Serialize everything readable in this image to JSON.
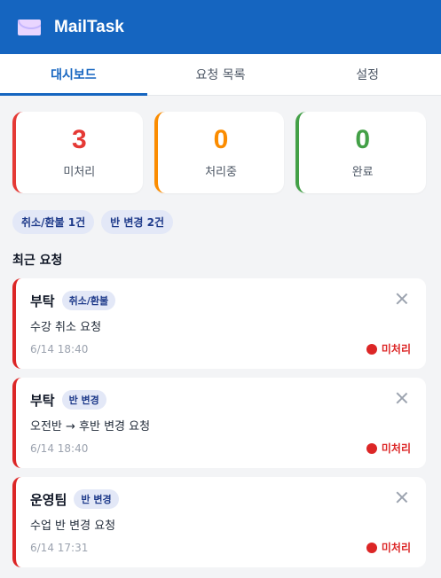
{
  "app": {
    "title": "MailTask",
    "icon": "envelope-icon"
  },
  "tabs": [
    {
      "label": "대시보드",
      "active": true
    },
    {
      "label": "요청 목록",
      "active": false
    },
    {
      "label": "설정",
      "active": false
    }
  ],
  "stats": [
    {
      "value": "3",
      "label": "미처리",
      "color": "#e53935"
    },
    {
      "value": "0",
      "label": "처리중",
      "color": "#fb8c00"
    },
    {
      "value": "0",
      "label": "완료",
      "color": "#43a047"
    }
  ],
  "chips": [
    {
      "label": "취소/환불 1건"
    },
    {
      "label": "반 변경 2건"
    }
  ],
  "recent": {
    "title": "최근 요청",
    "items": [
      {
        "sender": "부탁",
        "badge": "취소/환불",
        "subject": "수강 취소 요청",
        "time": "6/14 18:40",
        "status": "미처리"
      },
      {
        "sender": "부탁",
        "badge": "반 변경",
        "subject": "오전반 → 후반 변경 요청",
        "time": "6/14 18:40",
        "status": "미처리"
      },
      {
        "sender": "운영팀",
        "badge": "반 변경",
        "subject": "수업 반 변경 요청",
        "time": "6/14 17:31",
        "status": "미처리"
      }
    ]
  },
  "colors": {
    "primary": "#1565c0",
    "status_unprocessed": "#dc2626"
  }
}
